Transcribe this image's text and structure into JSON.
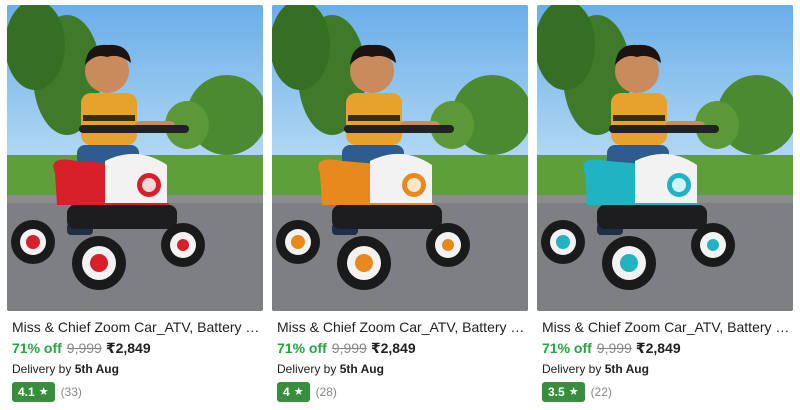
{
  "products": [
    {
      "title": "Miss & Chief Zoom Car_ATV, Battery o...",
      "discount": "71% off",
      "mrp": "9,999",
      "price": "₹2,849",
      "delivery_prefix": "Delivery by",
      "delivery_date": "5th Aug",
      "rating": "4.1",
      "reviews": "(33)",
      "accent_color": "#d8202a",
      "image_icon": "kid-atv-red-photo"
    },
    {
      "title": "Miss & Chief Zoom Car_ATV, Battery o...",
      "discount": "71% off",
      "mrp": "9,999",
      "price": "₹2,849",
      "delivery_prefix": "Delivery by",
      "delivery_date": "5th Aug",
      "rating": "4",
      "reviews": "(28)",
      "accent_color": "#e8891d",
      "image_icon": "kid-atv-orange-photo"
    },
    {
      "title": "Miss & Chief Zoom Car_ATV, Battery o...",
      "discount": "71% off",
      "mrp": "9,999",
      "price": "₹2,849",
      "delivery_prefix": "Delivery by",
      "delivery_date": "5th Aug",
      "rating": "3.5",
      "reviews": "(22)",
      "accent_color": "#1fb3c4",
      "image_icon": "kid-atv-teal-photo"
    }
  ],
  "colors": {
    "discount_green": "#26a541",
    "rating_green": "#388e3c",
    "muted_gray": "#878787"
  }
}
